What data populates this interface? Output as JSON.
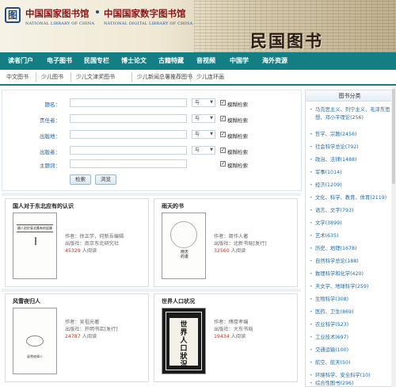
{
  "header": {
    "logo_glyph": "图",
    "library_name": "中国国家图书馆",
    "library_name_en": "NATIONAL LIBRARY OF CHINA",
    "digital_library_name": "中国国家数字图书馆",
    "digital_library_name_en": "NATIONAL DIGITAL LIBRARY OF CHINA",
    "collection_title": "民国图书"
  },
  "main_nav": [
    "读者门户",
    "电子图书",
    "民国专栏",
    "博士论文",
    "古籍特藏",
    "音视频",
    "中国学",
    "海外资源"
  ],
  "sub_nav": [
    "中文图书",
    "少儿图书",
    "少儿文津奖图书",
    "少儿新闻总署推荐图书",
    "少儿连环画"
  ],
  "search": {
    "fields": [
      {
        "label": "题名：",
        "value": "",
        "op": "与",
        "fuzzy": "模糊检索"
      },
      {
        "label": "责任者：",
        "value": "",
        "op": "与",
        "fuzzy": "模糊检索"
      },
      {
        "label": "出版地：",
        "value": "",
        "op": "与",
        "fuzzy": "模糊检索"
      },
      {
        "label": "出版者：",
        "value": "",
        "op": "与",
        "fuzzy": "模糊检索"
      },
      {
        "label": "主题词：",
        "value": "",
        "op": "",
        "fuzzy": "模糊检索"
      }
    ],
    "search_button": "检索",
    "browse_button": "浏览",
    "checked_mark": "✓",
    "caret": "▼"
  },
  "books": [
    {
      "title": "国人对于东北应有的认识",
      "author": "作者：徐正学，何新吾编辑",
      "publisher": "出版社：南京东北研究社",
      "views": "45329",
      "views_suffix": " 人阅读",
      "cover_text": "國人對於東北應有的認識"
    },
    {
      "title": "雨天的书",
      "author": "作者：周作人著",
      "publisher": "出版社：北新书局[发行]",
      "views": "32560",
      "views_suffix": " 人阅读",
      "cover_text": "雨天的書"
    },
    {
      "title": "风雪夜归人",
      "author": "作者：吴祖光著",
      "publisher": "出版社：开明书店[发行]",
      "views": "24787",
      "views_suffix": " 人阅读",
      "cover_text": "風雪夜歸人"
    },
    {
      "title": "世界人口状况",
      "author": "作者：傅厚孝编",
      "publisher": "出版社：大东书局",
      "views": "19434",
      "views_suffix": " 人阅读",
      "cover_text": "世界人口狀況"
    }
  ],
  "sidebar": {
    "title": "图书分类",
    "bullet": "•",
    "categories": [
      "马克思主义、列宁主义、毛泽东思想、邓小平理论(256)",
      "哲学、宗教(2456)",
      "社会科学总论(792)",
      "政治、法律(1488)",
      "军事(1014)",
      "经济(1209)",
      "文化、科学、教育、体育(2119)",
      "语言、文字(793)",
      "文学(3899)",
      "艺术(635)",
      "历史、地理(1678)",
      "自然科学总论(188)",
      "数理科学和化学(420)",
      "天文学、地球科学(259)",
      "生物科学(308)",
      "医药、卫生(869)",
      "农业科学(523)",
      "工业技术(697)",
      "交通运输(100)",
      "航空、航天(50)",
      "环境科学、安全科学(10)",
      "综合性图书(296)"
    ]
  },
  "colors": {
    "nav_bg": "#137f84",
    "link": "#1f6ca8",
    "views": "#c0392b",
    "brand_red": "#8a1518"
  }
}
